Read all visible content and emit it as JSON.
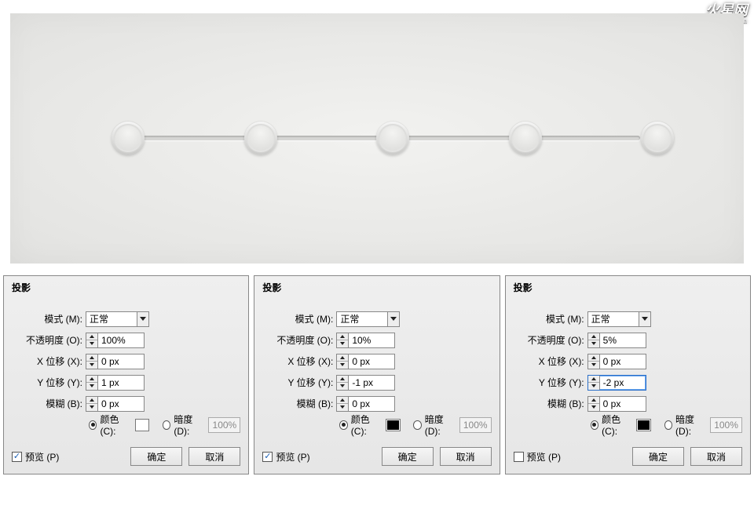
{
  "watermark": {
    "name": "火星网",
    "domain": "hxsd.com"
  },
  "preview_nodes": 5,
  "labels": {
    "mode": "模式 (M):",
    "opacity": "不透明度 (O):",
    "xoff": "X 位移 (X):",
    "yoff": "Y 位移 (Y):",
    "blur": "模糊 (B):",
    "color": "颜色 (C):",
    "darkness": "暗度 (D):",
    "preview": "预览 (P)",
    "ok": "确定",
    "cancel": "取消"
  },
  "panels": [
    {
      "title": "投影",
      "mode": "正常",
      "opacity": "100%",
      "xoff": "0 px",
      "yoff": "1 px",
      "yoff_focus": false,
      "blur": "0 px",
      "color_selected": true,
      "color_swatch": "#ffffff",
      "darkness_value": "100%",
      "preview_checked": true
    },
    {
      "title": "投影",
      "mode": "正常",
      "opacity": "10%",
      "xoff": "0 px",
      "yoff": "-1 px",
      "yoff_focus": false,
      "blur": "0 px",
      "color_selected": true,
      "color_swatch": "#000000",
      "darkness_value": "100%",
      "preview_checked": true
    },
    {
      "title": "投影",
      "mode": "正常",
      "opacity": "5%",
      "xoff": "0 px",
      "yoff": "-2 px",
      "yoff_focus": true,
      "blur": "0 px",
      "color_selected": true,
      "color_swatch": "#000000",
      "darkness_value": "100%",
      "preview_checked": false
    }
  ]
}
